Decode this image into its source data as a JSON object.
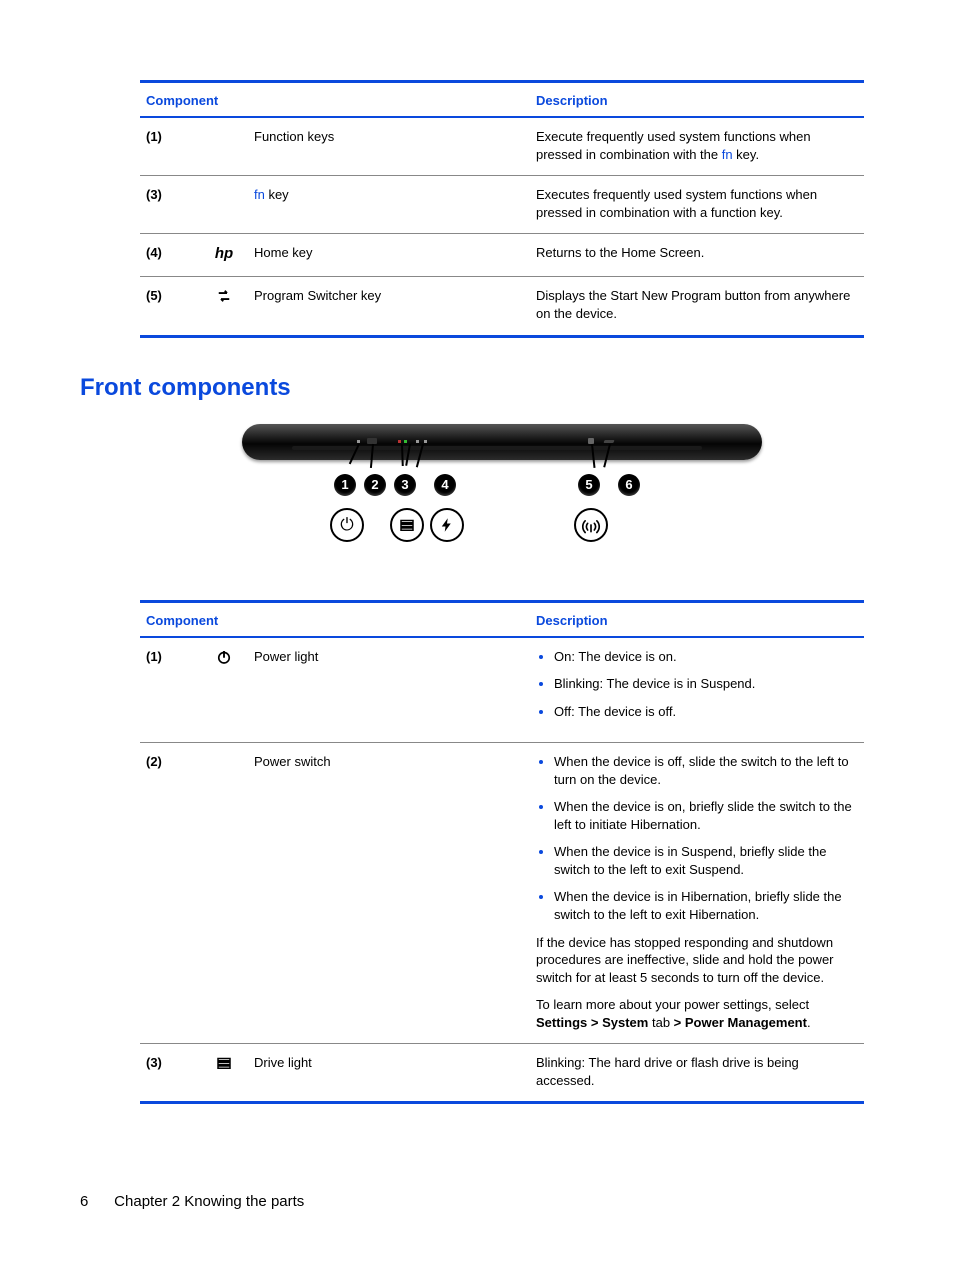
{
  "table1": {
    "head_component": "Component",
    "head_description": "Description",
    "rows": [
      {
        "num": "(1)",
        "icon": "",
        "name": "Function keys",
        "desc_pre": "Execute frequently used system functions when pressed in combination with the ",
        "desc_link": "fn",
        "desc_post": " key."
      },
      {
        "num": "(3)",
        "icon": "",
        "name_link": "fn",
        "name_post": " key",
        "desc": "Executes frequently used system functions when pressed in combination with a function key."
      },
      {
        "num": "(4)",
        "icon": "hp",
        "name": "Home key",
        "desc": "Returns to the Home Screen."
      },
      {
        "num": "(5)",
        "icon": "switcher",
        "name": "Program Switcher key",
        "desc": "Displays the Start New Program button from anywhere on the device."
      }
    ]
  },
  "section_heading": "Front components",
  "diagram_bubbles": [
    "1",
    "2",
    "3",
    "4",
    "5",
    "6"
  ],
  "table2": {
    "head_component": "Component",
    "head_description": "Description",
    "rows": [
      {
        "num": "(1)",
        "icon": "power",
        "name": "Power light",
        "bullets": [
          "On: The device is on.",
          "Blinking: The device is in Suspend.",
          "Off: The device is off."
        ]
      },
      {
        "num": "(2)",
        "icon": "",
        "name": "Power switch",
        "bullets": [
          "When the device is off, slide the switch to the left to turn on the device.",
          "When the device is on, briefly slide the switch to the left to initiate Hibernation.",
          "When the device is in Suspend, briefly slide the switch to the left to exit Suspend.",
          "When the device is in Hibernation, briefly slide the switch to the left to exit Hibernation."
        ],
        "para1": "If the device has stopped responding and shutdown procedures are ineffective, slide and hold the power switch for at least 5 seconds to turn off the device.",
        "para2_pre": "To learn more about your power settings, select ",
        "para2_b1": "Settings > System",
        "para2_mid": " tab ",
        "para2_b2": "> Power Management",
        "para2_post": "."
      },
      {
        "num": "(3)",
        "icon": "drive",
        "name": "Drive light",
        "desc": "Blinking: The hard drive or flash drive is being accessed."
      }
    ]
  },
  "footer": {
    "page_num": "6",
    "chapter": "Chapter 2   Knowing the parts"
  }
}
